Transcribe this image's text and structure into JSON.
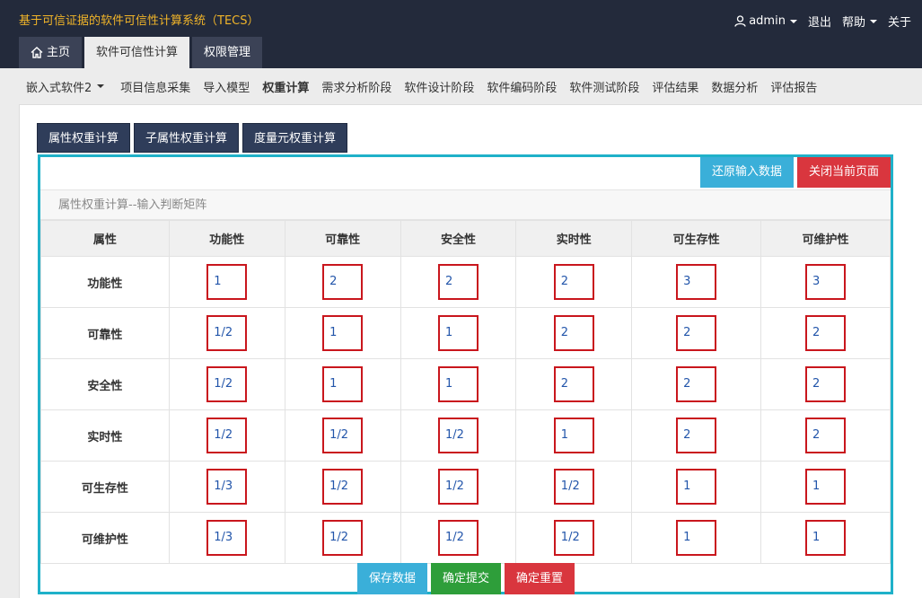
{
  "app": {
    "title": "基于可信证据的软件可信性计算系统（TECS）",
    "user": "admin",
    "logout": "退出",
    "help": "帮助",
    "about": "关于"
  },
  "tabs": [
    {
      "label": "主页",
      "active": false
    },
    {
      "label": "软件可信性计算",
      "active": true
    },
    {
      "label": "权限管理",
      "active": false
    }
  ],
  "subnav": {
    "project": "嵌入式软件2",
    "items": [
      "项目信息采集",
      "导入模型",
      "权重计算",
      "需求分析阶段",
      "软件设计阶段",
      "软件编码阶段",
      "软件测试阶段",
      "评估结果",
      "数据分析",
      "评估报告"
    ],
    "active": "权重计算"
  },
  "inner_tabs": [
    "属性权重计算",
    "子属性权重计算",
    "度量元权重计算"
  ],
  "actions": {
    "restore": "还原输入数据",
    "close": "关闭当前页面"
  },
  "caption": "属性权重计算--输入判断矩阵",
  "matrix": {
    "corner": "属性",
    "headers": [
      "功能性",
      "可靠性",
      "安全性",
      "实时性",
      "可生存性",
      "可维护性"
    ],
    "rows": [
      {
        "label": "功能性",
        "values": [
          "1",
          "2",
          "2",
          "2",
          "3",
          "3"
        ]
      },
      {
        "label": "可靠性",
        "values": [
          "1/2",
          "1",
          "1",
          "2",
          "2",
          "2"
        ]
      },
      {
        "label": "安全性",
        "values": [
          "1/2",
          "1",
          "1",
          "2",
          "2",
          "2"
        ]
      },
      {
        "label": "实时性",
        "values": [
          "1/2",
          "1/2",
          "1/2",
          "1",
          "2",
          "2"
        ]
      },
      {
        "label": "可生存性",
        "values": [
          "1/3",
          "1/2",
          "1/2",
          "1/2",
          "1",
          "1"
        ]
      },
      {
        "label": "可维护性",
        "values": [
          "1/3",
          "1/2",
          "1/2",
          "1/2",
          "1",
          "1"
        ]
      }
    ]
  },
  "bottom": {
    "save": "保存数据",
    "submit": "确定提交",
    "reset": "确定重置"
  },
  "colors": {
    "header_bg": "#232a3b",
    "title": "#f0b429",
    "frame_border": "#1fb1c9",
    "input_border": "#c9161d",
    "info": "#3aafd9",
    "danger": "#d9363e",
    "success": "#2e9e3a"
  }
}
